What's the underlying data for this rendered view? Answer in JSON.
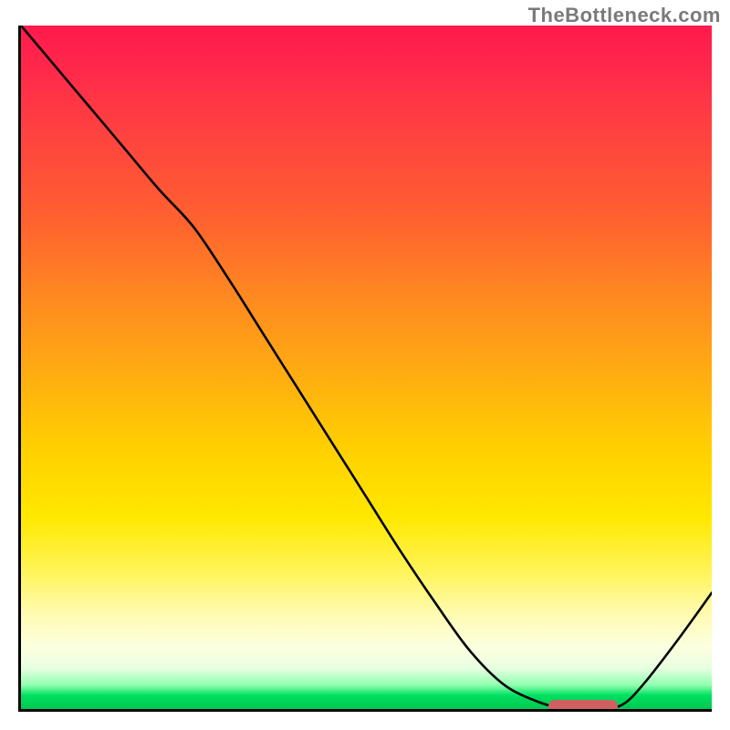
{
  "watermark": "TheBottleneck.com",
  "chart_data": {
    "type": "line",
    "title": "",
    "xlabel": "",
    "ylabel": "",
    "xlim": [
      0,
      100
    ],
    "ylim": [
      0,
      100
    ],
    "x": [
      0,
      5,
      10,
      15,
      20,
      25,
      30,
      35,
      40,
      45,
      50,
      55,
      60,
      65,
      70,
      75,
      78,
      81,
      84,
      87,
      90,
      95,
      100
    ],
    "values": [
      100,
      94,
      88,
      82,
      76,
      70.5,
      63,
      55,
      47,
      39,
      31,
      23,
      15.5,
      8.5,
      3.5,
      1.0,
      0.3,
      0.2,
      0.2,
      0.6,
      3.5,
      10,
      17
    ],
    "sweet_spot": {
      "x_start": 76,
      "x_end": 86,
      "y": 0.8
    },
    "grid": false,
    "legend": false,
    "background_gradient": [
      "#ff1a4d",
      "#ffd000",
      "#00c850"
    ]
  }
}
